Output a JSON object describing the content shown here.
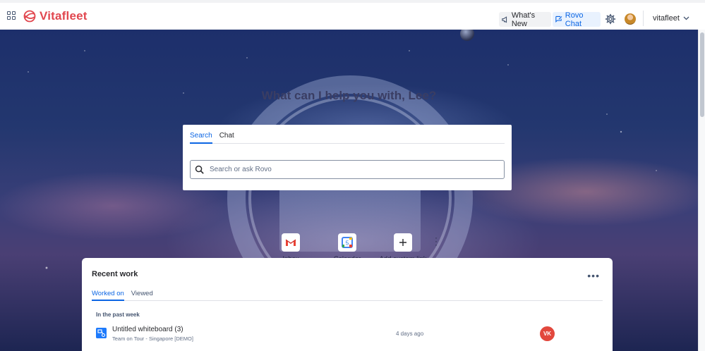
{
  "app": {
    "logo_text": "Vitafleet",
    "brand_color": "#e1474f",
    "accent_color": "#0c66e4"
  },
  "topbar": {
    "apps_icon": "grid-icon",
    "whats_new_label": "What's New",
    "rovo_chat_label": "Rovo Chat",
    "settings_icon": "gear-icon",
    "site_name": "vitafleet"
  },
  "hero": {
    "greeting": "What can I help you with, Lee?",
    "tabs": [
      {
        "label": "Search",
        "active": true
      },
      {
        "label": "Chat",
        "active": false
      }
    ],
    "search_placeholder": "Search or ask Rovo"
  },
  "quick_links": [
    {
      "label": "Inbox",
      "icon": "gmail-icon"
    },
    {
      "label": "Calendar",
      "icon": "calendar-icon",
      "badge": "5"
    },
    {
      "label": "Add custom link",
      "icon": "plus-icon"
    }
  ],
  "recent_work": {
    "title": "Recent work",
    "tabs": [
      {
        "label": "Worked on",
        "active": true
      },
      {
        "label": "Viewed",
        "active": false
      }
    ],
    "period_label": "In the past week",
    "items": [
      {
        "title": "Untitled whiteboard (3)",
        "subtitle": "Team on Tour - Singapore [DEMO]",
        "time": "4 days ago",
        "avatar_initials": "VK",
        "avatar_color": "#e2483d",
        "icon": "whiteboard-icon"
      }
    ]
  }
}
